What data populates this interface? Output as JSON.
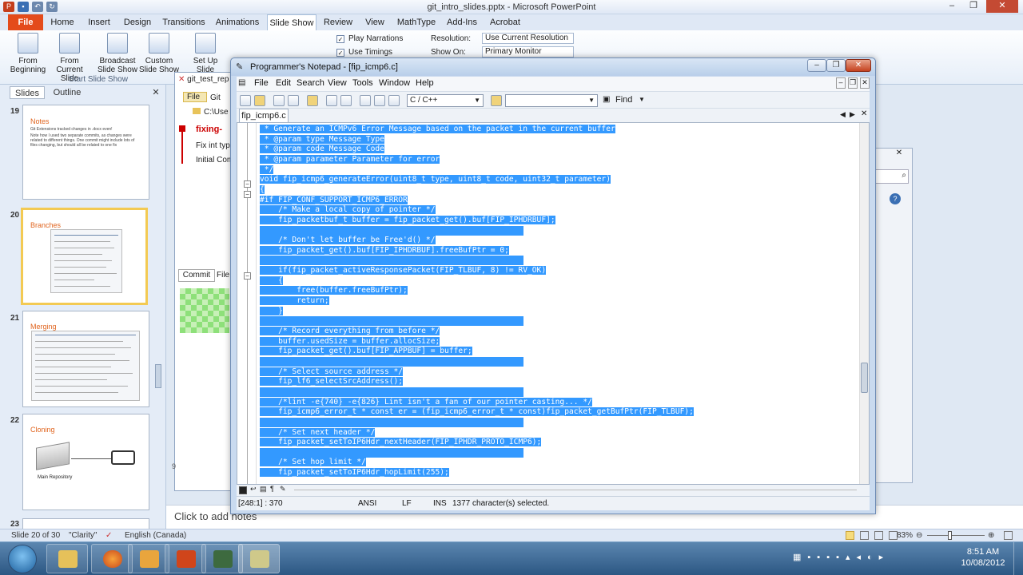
{
  "powerpoint": {
    "title": "git_intro_slides.pptx - Microsoft PowerPoint",
    "ribbon_tabs": [
      "File",
      "Home",
      "Insert",
      "Design",
      "Transitions",
      "Animations",
      "Slide Show",
      "Review",
      "View",
      "MathType",
      "Add-Ins",
      "Acrobat"
    ],
    "ribbon": {
      "from_beginning": "From Beginning",
      "from_current": "From Current Slide",
      "broadcast": "Broadcast Slide Show",
      "custom": "Custom Slide Show",
      "group_start": "Start Slide Show",
      "set_up": "Set Up Slide Show",
      "play_narrations": "Play Narrations",
      "use_timings": "Use Timings",
      "resolution_label": "Resolution:",
      "resolution_value": "Use Current Resolution",
      "show_on_label": "Show On:",
      "show_on_value": "Primary Monitor"
    },
    "panel_tabs": {
      "slides": "Slides",
      "outline": "Outline"
    },
    "slides": [
      {
        "number": "19",
        "title": "Notes",
        "bullets": [
          "Git Extensions tracked changes in .docx even!",
          "Note how I used two separate commits, as changes were related to different things. One commit might include lots of files changing, but should all be related to one fix"
        ]
      },
      {
        "number": "20",
        "title": "Branches"
      },
      {
        "number": "21",
        "title": "Merging"
      },
      {
        "number": "22",
        "title": "Cloning",
        "caption": "Main Repository"
      },
      {
        "number": "23"
      }
    ],
    "notes_placeholder": "Click to add notes",
    "status": {
      "slide": "Slide 20 of 30",
      "theme": "\"Clarity\"",
      "language": "English (Canada)",
      "zoom": "83%"
    }
  },
  "git_window": {
    "title": "git_test_rep",
    "menu": [
      "File",
      "Git"
    ],
    "path": "C:\\Use",
    "commits": [
      "fixing-",
      "Fix int typ",
      "Initial Com"
    ],
    "tabs": [
      "Commit",
      "File"
    ]
  },
  "notepad": {
    "title": "Programmer's Notepad - [fip_icmp6.c]",
    "menu": [
      "File",
      "Edit",
      "Search",
      "View",
      "Tools",
      "Window",
      "Help"
    ],
    "language": "C / C++",
    "find_label": "Find",
    "tab": "fip_icmp6.c",
    "code_lines": [
      " * Generate an ICMPv6 Error Message based on the packet in the current buffer",
      " * @param type Message Type",
      " * @param code Message Code",
      " * @param parameter Parameter for error",
      " */",
      "void fip_icmp6_generateError(uint8_t type, uint8_t code, uint32_t parameter)",
      "{",
      "#if FIP_CONF_SUPPORT_ICMP6_ERROR",
      "    /* Make a local copy of pointer */",
      "    fip_packetbuf_t buffer = fip_packet_get().buf[FIP_IPHDRBUF];",
      "",
      "    /* Don't let buffer be Free'd() */",
      "    fip_packet_get().buf[FIP_IPHDRBUF].freeBufPtr = 0;",
      "",
      "    if(fip_packet_activeResponsePacket(FIP_TLBUF, 8) != RV_OK)",
      "    {",
      "        free(buffer.freeBufPtr);",
      "        return;",
      "    }",
      "",
      "    /* Record everything from before */",
      "    buffer.usedSize = buffer.allocSize;",
      "    fip_packet_get().buf[FIP_APPBUF] = buffer;",
      "",
      "    /* Select source address */",
      "    fip_lf6_selectSrcAddress();",
      "",
      "    /*lint -e{740} -e{826} Lint isn't a fan of our pointer casting... */",
      "    fip_icmp6_error_t * const er = (fip_icmp6_error_t * const)fip_packet_getBufPtr(FIP_TLBUF);",
      "",
      "    /* Set next header */",
      "    fip_packet_setToIP6Hdr_nextHeader(FIP_IPHDR_PROTO_ICMP6);",
      "",
      "    /* Set hop limit */",
      "    fip_packet_setToIP6Hdr_hopLimit(255);"
    ],
    "status": {
      "position": "[248:1] : 370",
      "encoding": "ANSI",
      "line_ending": "LF",
      "mode": "INS",
      "selection": "1377 character(s) selected."
    }
  },
  "taskbar": {
    "time": "8:51 AM",
    "date": "10/08/2012",
    "items": [
      "explorer-icon",
      "firefox-icon",
      "outlook-icon",
      "powerpoint-icon",
      "git-extensions-icon",
      "notepad-icon"
    ]
  },
  "colors": {
    "selection": "#3399ff",
    "file_tab": "#e44b1b",
    "accent_orange": "#e0641e",
    "taskbar": "#2c5783"
  }
}
